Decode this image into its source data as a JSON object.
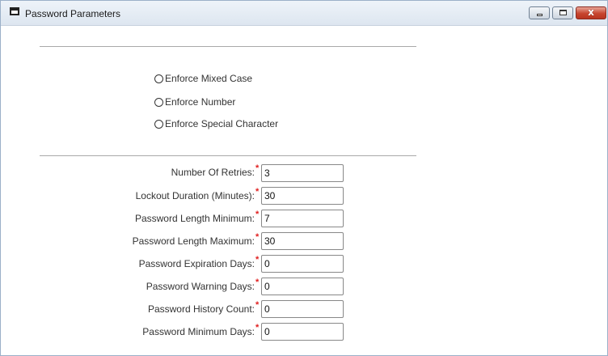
{
  "window": {
    "title": "Password Parameters"
  },
  "options": [
    {
      "label": "Enforce Mixed Case",
      "checked": false
    },
    {
      "label": "Enforce Number",
      "checked": false
    },
    {
      "label": "Enforce Special Character",
      "checked": false
    }
  ],
  "fields": [
    {
      "label": "Number Of Retries:",
      "required_mark": "*",
      "value": "3"
    },
    {
      "label": "Lockout Duration (Minutes):",
      "required_mark": "*",
      "value": "30"
    },
    {
      "label": "Password Length Minimum:",
      "required_mark": "*",
      "value": "7"
    },
    {
      "label": "Password Length Maximum:",
      "required_mark": "*",
      "value": "30"
    },
    {
      "label": "Password Expiration Days:",
      "required_mark": "*",
      "value": "0"
    },
    {
      "label": "Password Warning Days:",
      "required_mark": "*",
      "value": "0"
    },
    {
      "label": "Password History Count:",
      "required_mark": "*",
      "value": "0"
    },
    {
      "label": "Password Minimum Days:",
      "required_mark": "*",
      "value": "0"
    }
  ],
  "colors": {
    "required_star": "#e02020",
    "close_button": "#c7452f"
  }
}
